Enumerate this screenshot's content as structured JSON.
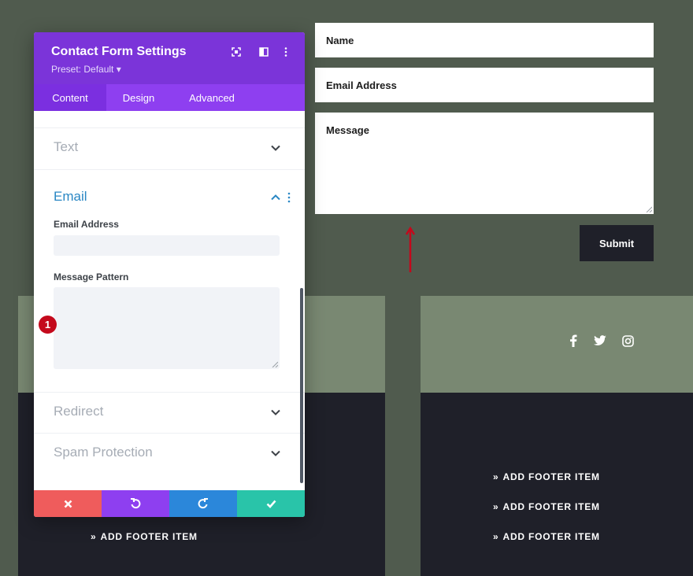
{
  "panel": {
    "title": "Contact Form Settings",
    "preset": "Preset: Default ▾",
    "tabs": [
      "Content",
      "Design",
      "Advanced"
    ],
    "active_tab": "Content",
    "sections": {
      "text": "Text",
      "email": "Email",
      "redirect": "Redirect",
      "spam": "Spam Protection"
    },
    "email_address_label": "Email Address",
    "email_address_value": "",
    "message_pattern_label": "Message Pattern",
    "message_pattern_value": "",
    "badge": "1"
  },
  "form": {
    "name_label": "Name",
    "email_label": "Email Address",
    "message_label": "Message",
    "submit_label": "Submit"
  },
  "footer": {
    "item_label": "ADD FOOTER ITEM",
    "chevron": "»"
  },
  "colors": {
    "accent_purple": "#7b34d9",
    "email_blue": "#2a87c4",
    "badge_red": "#c4091c",
    "cancel": "#ef5c5c",
    "undo": "#8e3ff0",
    "redo": "#2b87da",
    "save": "#29c4a9",
    "bg_olive": "#505b4e",
    "sage": "#798872",
    "dark": "#1f2029"
  },
  "icons": [
    "fullscreen-icon",
    "split-view-icon",
    "more-options-icon",
    "chevron-down-icon",
    "chevron-up-icon",
    "close-icon",
    "undo-icon",
    "redo-icon",
    "check-icon",
    "facebook-icon",
    "twitter-icon",
    "instagram-icon",
    "arrow-up-icon"
  ]
}
